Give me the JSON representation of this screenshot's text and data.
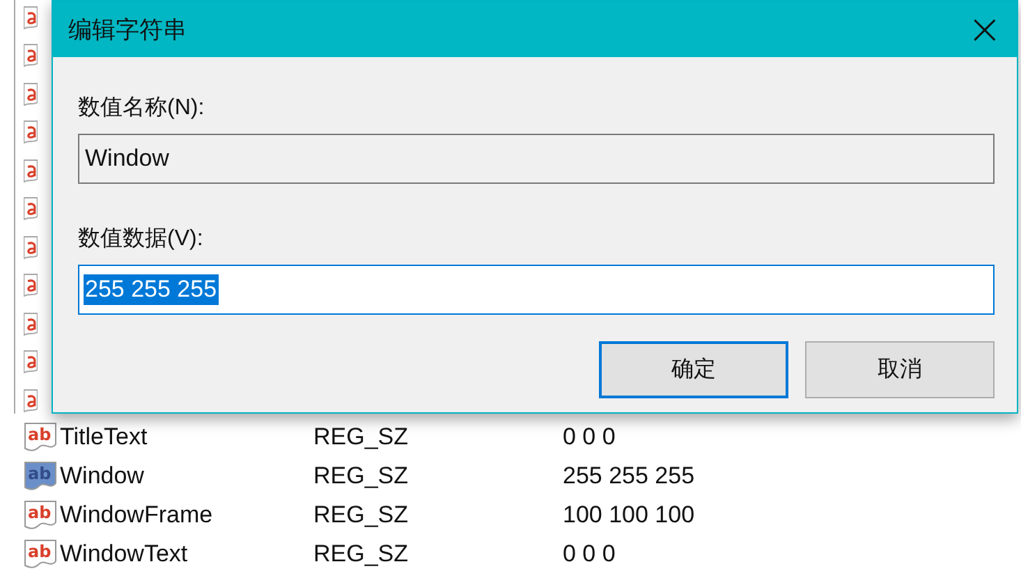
{
  "dialog": {
    "title": "编辑字符串",
    "close": "×",
    "name_label": "数值名称(N):",
    "name_field": {
      "value": "Window",
      "readonly": true
    },
    "data_label": "数值数据(V):",
    "data_field": {
      "value": "255 255 255",
      "readonly": false,
      "selected": true
    },
    "buttons": [
      {
        "label": "确定",
        "default": true
      },
      {
        "label": "取消",
        "default": false
      }
    ]
  },
  "values": [
    {
      "icon": "ab",
      "name": "TitleText",
      "type": "REG_SZ",
      "data": "0 0 0",
      "selected": false
    },
    {
      "icon": "ab",
      "name": "Window",
      "type": "REG_SZ",
      "data": "255 255 255",
      "selected": true
    },
    {
      "icon": "ab",
      "name": "WindowFrame",
      "type": "REG_SZ",
      "data": "100 100 100",
      "selected": false
    },
    {
      "icon": "ab",
      "name": "WindowText",
      "type": "REG_SZ",
      "data": "0 0 0",
      "selected": false
    }
  ]
}
